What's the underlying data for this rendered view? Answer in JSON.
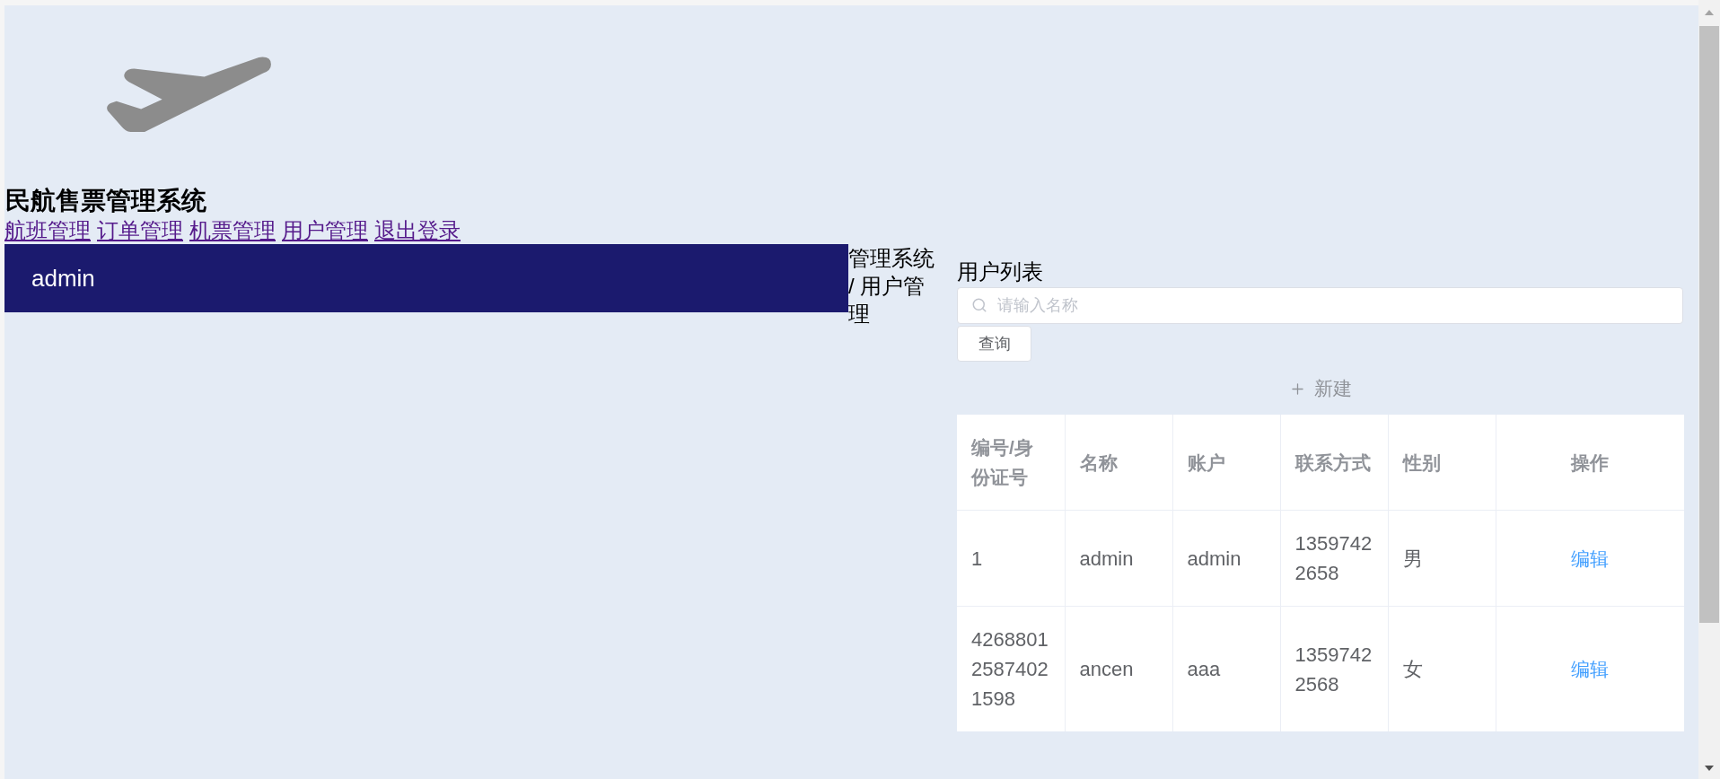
{
  "header": {
    "title": "民航售票管理系统",
    "nav": [
      "航班管理",
      "订单管理",
      "机票管理",
      "用户管理",
      "退出登录"
    ]
  },
  "sidebar": {
    "username": "admin"
  },
  "breadcrumb": "管理系统 / 用户管理",
  "content": {
    "title": "用户列表",
    "search": {
      "placeholder": "请输入名称"
    },
    "search_button": "查询",
    "new_button": "新建",
    "table": {
      "columns": [
        "编号/身份证号",
        "名称",
        "账户",
        "联系方式",
        "性别",
        "操作"
      ],
      "rows": [
        {
          "cells": [
            "1",
            "admin",
            "admin",
            "13597422658",
            "男"
          ],
          "action": "编辑"
        },
        {
          "cells": [
            "426880125874021598",
            "ancen",
            "aaa",
            "13597422568",
            "女"
          ],
          "action": "编辑"
        }
      ]
    }
  }
}
